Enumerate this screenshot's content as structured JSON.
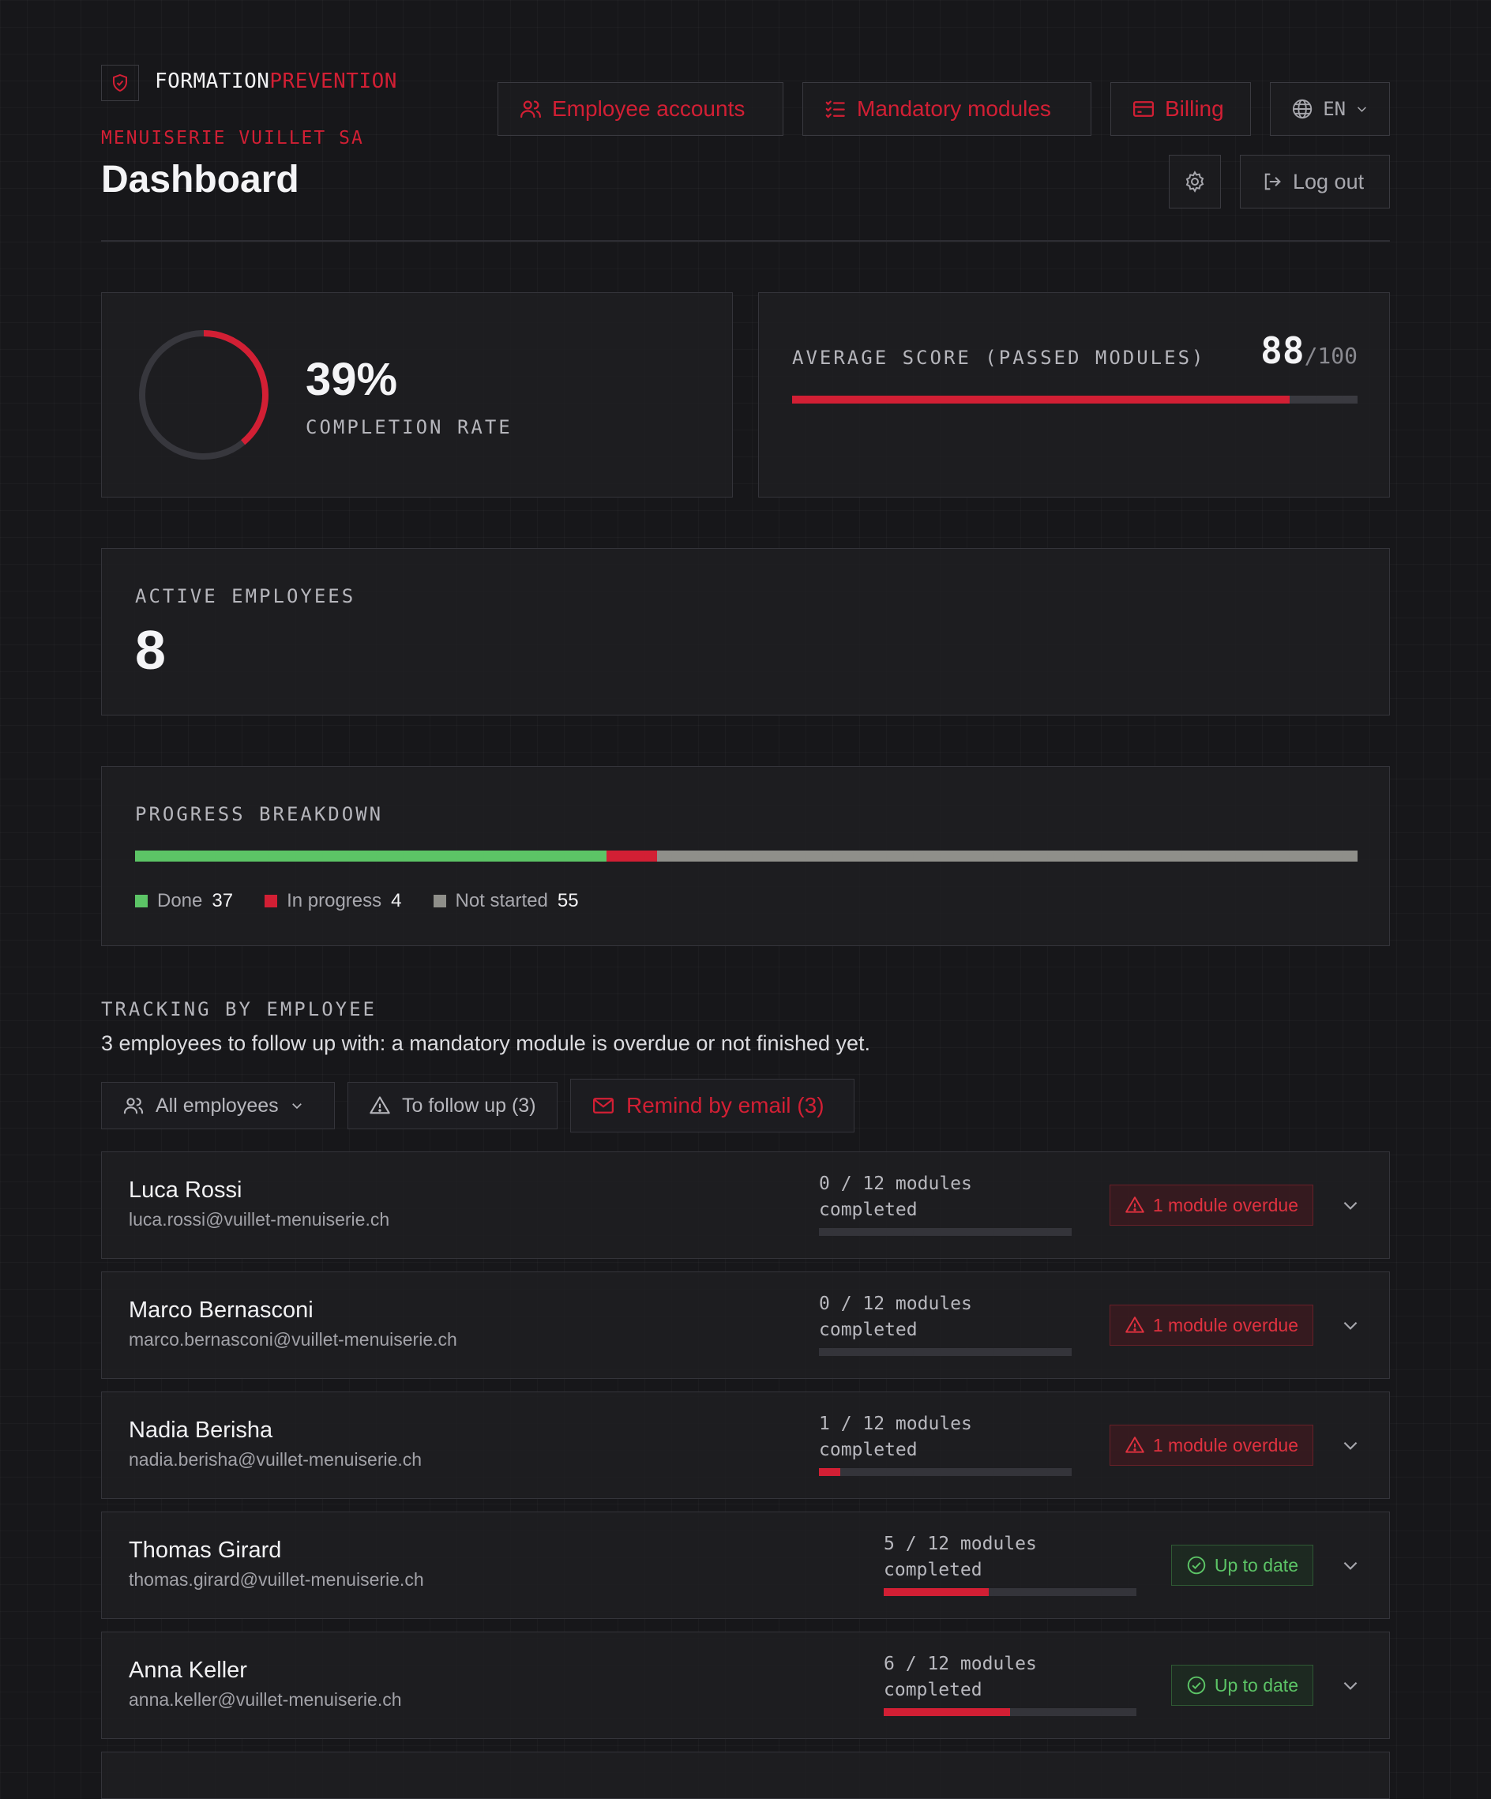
{
  "brand": {
    "part1": "FORMATION",
    "part2": "PREVENTION"
  },
  "header": {
    "company": "MENUISERIE VUILLET SA",
    "title": "Dashboard",
    "nav": {
      "employees": "Employee accounts",
      "modules": "Mandatory modules",
      "billing": "Billing",
      "lang": "EN"
    },
    "logout": "Log out"
  },
  "completion": {
    "value": "39%",
    "fraction": 0.39,
    "label": "COMPLETION RATE"
  },
  "score": {
    "label": "AVERAGE SCORE (PASSED MODULES)",
    "value": "88",
    "max": "/100",
    "fraction": 0.88
  },
  "active": {
    "label": "ACTIVE EMPLOYEES",
    "value": "8"
  },
  "breakdown": {
    "label": "PROGRESS BREAKDOWN",
    "done_label": "Done",
    "done": "37",
    "progress_label": "In progress",
    "progress": "4",
    "notstarted_label": "Not started",
    "notstarted": "55",
    "colors": {
      "done": "#5cc466",
      "progress": "#d21f34",
      "notstarted": "#8f8f8a"
    }
  },
  "tracking": {
    "label": "TRACKING BY EMPLOYEE",
    "summary": "3 employees to follow up with: a mandatory module is overdue or not finished yet.",
    "filter_all": "All employees",
    "filter_follow": "To follow up (3)",
    "remind": "Remind by email (3)"
  },
  "employees": [
    {
      "name": "Luca Rossi",
      "email": "luca.rossi@vuillet-menuiserie.ch",
      "progress": "0 / 12 modules completed",
      "done": 0,
      "total": 12,
      "status": "1 module overdue",
      "state": "overdue"
    },
    {
      "name": "Marco Bernasconi",
      "email": "marco.bernasconi@vuillet-menuiserie.ch",
      "progress": "0 / 12 modules completed",
      "done": 0,
      "total": 12,
      "status": "1 module overdue",
      "state": "overdue"
    },
    {
      "name": "Nadia Berisha",
      "email": "nadia.berisha@vuillet-menuiserie.ch",
      "progress": "1 / 12 modules completed",
      "done": 1,
      "total": 12,
      "status": "1 module overdue",
      "state": "overdue"
    },
    {
      "name": "Thomas Girard",
      "email": "thomas.girard@vuillet-menuiserie.ch",
      "progress": "5 / 12 modules completed",
      "done": 5,
      "total": 12,
      "status": "Up to date",
      "state": "ok"
    },
    {
      "name": "Anna Keller",
      "email": "anna.keller@vuillet-menuiserie.ch",
      "progress": "6 / 12 modules completed",
      "done": 6,
      "total": 12,
      "status": "Up to date",
      "state": "ok"
    }
  ]
}
